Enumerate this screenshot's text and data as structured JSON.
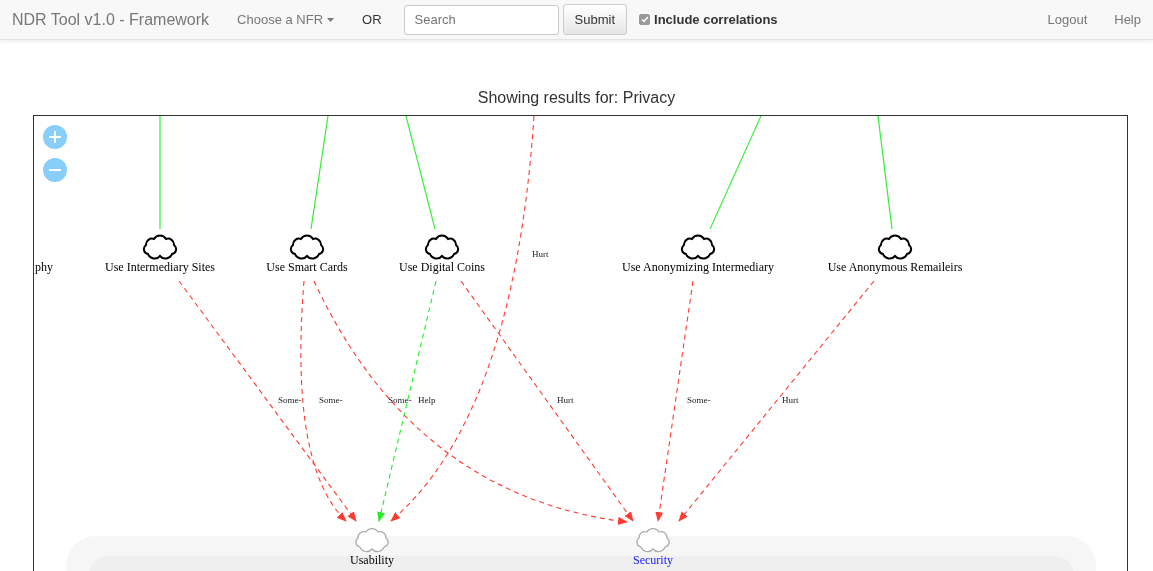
{
  "navbar": {
    "brand": "NDR Tool v1.0 - Framework",
    "dropdown": "Choose a NFR",
    "or_label": "OR",
    "search": {
      "placeholder": "Search"
    },
    "submit": "Submit",
    "include_correlations": {
      "label": "Include correlations",
      "checked": true
    },
    "links": [
      "Logout",
      "Help"
    ]
  },
  "heading": "Showing results for: Privacy",
  "diagram": {
    "nodes": [
      {
        "label": "phy",
        "kind": "operationalization",
        "parent_link": false,
        "highlighted": false
      },
      {
        "label": "Use Intermediary Sites",
        "kind": "operationalization",
        "parent_link": true,
        "highlighted": false
      },
      {
        "label": "Use Smart Cards",
        "kind": "operationalization",
        "parent_link": true,
        "highlighted": false
      },
      {
        "label": "Use Digital Coins",
        "kind": "operationalization",
        "parent_link": true,
        "highlighted": false
      },
      {
        "label": "Use Anonymizing Intermediary",
        "kind": "operationalization",
        "parent_link": true,
        "highlighted": false
      },
      {
        "label": "Use Anonymous Remaileirs",
        "kind": "operationalization",
        "parent_link": true,
        "highlighted": false
      },
      {
        "label": "Usability",
        "kind": "softgoal",
        "parent_link": false,
        "highlighted": false
      },
      {
        "label": "Security",
        "kind": "softgoal",
        "parent_link": false,
        "highlighted": true
      }
    ],
    "edges": [
      {
        "label": "Some-",
        "color": "#ff3b30"
      },
      {
        "label": "Some-",
        "color": "#ff3b30"
      },
      {
        "label": "Some-",
        "color": "#ff3b30"
      },
      {
        "label": "Help",
        "color": "#22ee22"
      },
      {
        "label": "Hurt",
        "color": "#ff3b30"
      },
      {
        "label": "Hurt",
        "color": "#ff3b30"
      },
      {
        "label": "Some-",
        "color": "#ff3b30"
      },
      {
        "label": "Hurt",
        "color": "#ff3b30"
      }
    ]
  }
}
